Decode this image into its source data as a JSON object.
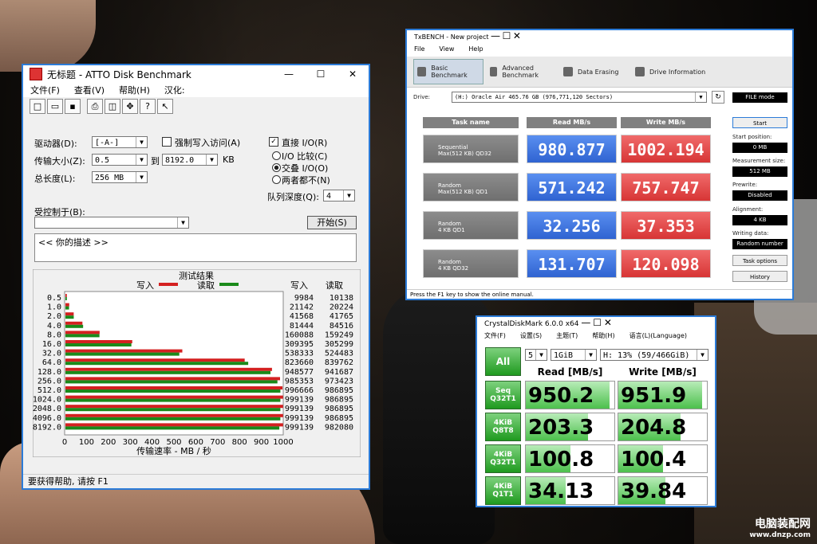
{
  "atto": {
    "title": "无标题 - ATTO Disk Benchmark",
    "menu": [
      "文件(F)",
      "查看(V)",
      "帮助(H)",
      "汉化:"
    ],
    "drive_label": "驱动器(D):",
    "drive_value": "[-A-]",
    "transfer_label": "传输大小(Z):",
    "transfer_from": "0.5",
    "transfer_to_label": "到",
    "transfer_to": "8192.0",
    "transfer_unit": "KB",
    "length_label": "总长度(L):",
    "length_value": "256 MB",
    "force_write_label": "强制写入访问(A)",
    "direct_io_label": "直接 I/O(R)",
    "io_compare_label": "I/O 比较(C)",
    "overlap_io_label": "交叠 I/O(O)",
    "neither_label": "两者都不(N)",
    "queue_label": "队列深度(Q):",
    "queue_value": "4",
    "controlled_label": "受控制于(B):",
    "start_button": "开始(S)",
    "description": "<<  你的描述   >>",
    "results_title": "测试结果",
    "legend_write": "写入",
    "legend_read": "读取",
    "col_write": "写入",
    "col_read": "读取",
    "x_axis_label": "传输速率 - MB / 秒",
    "status": "要获得帮助, 请按 F1",
    "write_color": "#d42020",
    "read_color": "#1a8a1a"
  },
  "chart_data": {
    "type": "bar",
    "title": "测试结果",
    "xlabel": "传输速率 - MB / 秒",
    "ylabel": "",
    "xlim": [
      0,
      1000
    ],
    "xticks": [
      "0",
      "100",
      "200",
      "300",
      "400",
      "500",
      "600",
      "700",
      "800",
      "900",
      "1000"
    ],
    "categories": [
      "0.5",
      "1.0",
      "2.0",
      "4.0",
      "8.0",
      "16.0",
      "32.0",
      "64.0",
      "128.0",
      "256.0",
      "512.0",
      "1024.0",
      "2048.0",
      "4096.0",
      "8192.0"
    ],
    "series": [
      {
        "name": "写入",
        "values": [
          9984,
          21142,
          41568,
          81444,
          160088,
          309395,
          538333,
          823660,
          948577,
          985353,
          996666,
          999139,
          999139,
          999139,
          999139
        ]
      },
      {
        "name": "读取",
        "values": [
          10138,
          20224,
          41765,
          84516,
          159249,
          305299,
          524483,
          839762,
          941687,
          973423,
          986895,
          986895,
          986895,
          986895,
          982080
        ]
      }
    ]
  },
  "txbench": {
    "title": "TxBENCH - New project",
    "menu": [
      "File",
      "View",
      "Help"
    ],
    "tabs": [
      "Basic Benchmark",
      "Advanced Benchmark",
      "Data Erasing",
      "Drive Information"
    ],
    "drive_label": "Drive:",
    "drive_value": "(H:) Oracle Air  465.76 GB (976,771,120 Sectors)",
    "file_mode": "FILE mode",
    "col_task": "Task name",
    "col_read": "Read MB/s",
    "col_write": "Write MB/s",
    "rows": [
      {
        "name1": "Sequential",
        "name2": "Max(512 KB) QD32",
        "read": "980.877",
        "write": "1002.194"
      },
      {
        "name1": "Random",
        "name2": "Max(512 KB) QD1",
        "read": "571.242",
        "write": "757.747"
      },
      {
        "name1": "Random",
        "name2": "4 KB QD1",
        "read": "32.256",
        "write": "37.353"
      },
      {
        "name1": "Random",
        "name2": "4 KB QD32",
        "read": "131.707",
        "write": "120.098"
      }
    ],
    "start": "Start",
    "start_pos_label": "Start position:",
    "start_pos": "0 MB",
    "meas_label": "Measurement size:",
    "meas": "512 MB",
    "prewrite_label": "Prewrite:",
    "prewrite": "Disabled",
    "align_label": "Alignment:",
    "align": "4 KB",
    "writing_label": "Writing data:",
    "writing": "Random number",
    "task_options": "Task options",
    "history": "History",
    "status": "Press the F1 key to show the online manual."
  },
  "cdm": {
    "title": "CrystalDiskMark 6.0.0 x64",
    "menu": [
      "文件(F)",
      "设置(S)",
      "主题(T)",
      "帮助(H)",
      "语言(L)(Language)"
    ],
    "all": "All",
    "count": "5",
    "size": "1GiB",
    "drive": "H: 13% (59/466GiB)",
    "read_header": "Read [MB/s]",
    "write_header": "Write [MB/s]",
    "rows": [
      {
        "l1": "Seq",
        "l2": "Q32T1",
        "read": "950.2",
        "write": "951.9",
        "rf": 0.95,
        "wf": 0.95
      },
      {
        "l1": "4KiB",
        "l2": "Q8T8",
        "read": "203.3",
        "write": "204.8",
        "rf": 0.7,
        "wf": 0.7
      },
      {
        "l1": "4KiB",
        "l2": "Q32T1",
        "read": "100.8",
        "write": "100.4",
        "rf": 0.5,
        "wf": 0.5
      },
      {
        "l1": "4KiB",
        "l2": "Q1T1",
        "read": "34.13",
        "write": "39.84",
        "rf": 0.45,
        "wf": 0.53
      }
    ]
  },
  "watermark": {
    "cn": "电脑装配网",
    "url": "www.dnzp.com"
  }
}
